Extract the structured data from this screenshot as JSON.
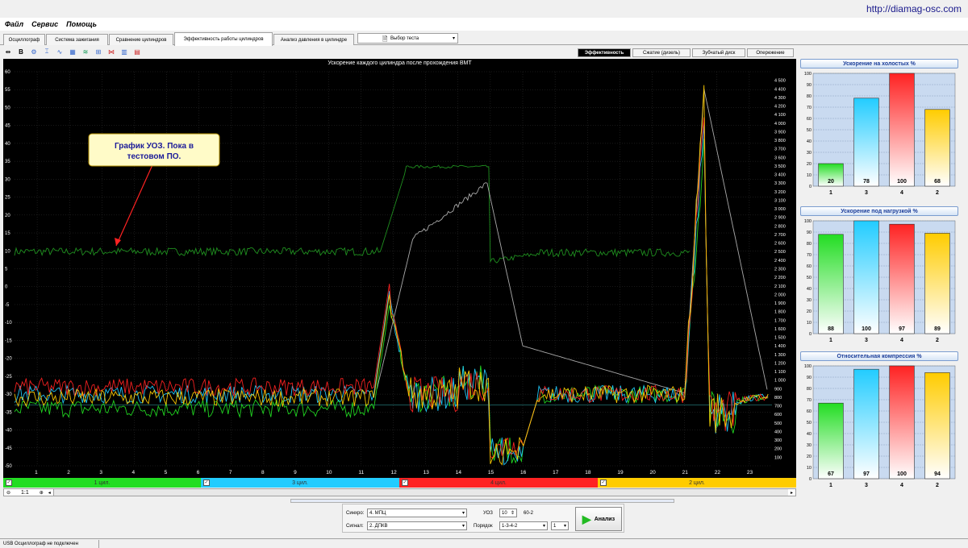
{
  "watermark": "http://diamag-osc.com",
  "menu": [
    "Файл",
    "Сервис",
    "Помощь"
  ],
  "tabs": [
    {
      "label": "Осциллограф",
      "active": false
    },
    {
      "label": "Система зажигания",
      "active": false
    },
    {
      "label": "Сравнение цилиндров",
      "active": false
    },
    {
      "label": "Эффективность работы цилиндров",
      "active": true
    },
    {
      "label": "Анализ давления в цилиндре",
      "active": false
    }
  ],
  "test_select": "Выбор теста",
  "toolbar_icons": [
    "zoom-icon",
    "bold-b-icon",
    "engine-icon",
    "cursor-icon",
    "wave-icon",
    "grid-icon",
    "align-icon",
    "split-icon",
    "compare-icon",
    "bar-chart-icon",
    "bars-icon"
  ],
  "subtabs": [
    {
      "label": "Эффективность",
      "active": true
    },
    {
      "label": "Сжатие (дизель)",
      "active": false
    },
    {
      "label": "Зубчатый диск",
      "active": false
    },
    {
      "label": "Опережение",
      "active": false
    }
  ],
  "plot": {
    "title": "Ускорение каждого цилиндра после прохождения ВМТ",
    "annotation": "График УОЗ. Пока в тестовом ПО.",
    "left_axis": {
      "min": -50,
      "max": 60,
      "step": 5
    },
    "right_axis": {
      "min": 100,
      "max": 4500,
      "step": 100
    },
    "x_axis": {
      "min": 1,
      "max": 23,
      "step": 1
    }
  },
  "channels": [
    {
      "label": "1 цил.",
      "color": "#22dd22"
    },
    {
      "label": "3 цил.",
      "color": "#22ccff"
    },
    {
      "label": "4 цил.",
      "color": "#ff2222"
    },
    {
      "label": "2 цил.",
      "color": "#ffcc00"
    }
  ],
  "zoom_ratio": "1:1",
  "chart_data": [
    {
      "type": "bar",
      "title": "Ускорение на холостых %",
      "categories": [
        "1",
        "3",
        "4",
        "2"
      ],
      "values": [
        20,
        78,
        100,
        68
      ],
      "ylim": [
        0,
        100
      ]
    },
    {
      "type": "bar",
      "title": "Ускорение под нагрузкой %",
      "categories": [
        "1",
        "3",
        "4",
        "2"
      ],
      "values": [
        88,
        100,
        97,
        89
      ],
      "ylim": [
        0,
        100
      ]
    },
    {
      "type": "bar",
      "title": "Относительная компрессия %",
      "categories": [
        "1",
        "3",
        "4",
        "2"
      ],
      "values": [
        67,
        97,
        100,
        94
      ],
      "ylim": [
        0,
        100
      ]
    }
  ],
  "bar_colors": [
    "#22dd22",
    "#22ccff",
    "#ff2222",
    "#ffcc00"
  ],
  "controls": {
    "sync_label": "Синхро:",
    "sync_value": "4. МПЦ",
    "signal_label": "Сигнал:",
    "signal_value": "2. ДПКВ",
    "uoz_label": "УОЗ",
    "uoz_value": "10",
    "teeth": "60-2",
    "order_label": "Порядок",
    "order_value": "1-3-4-2",
    "order_num": "1",
    "analyze": "Анализ"
  },
  "status": "USB Осциллограф не подключен"
}
